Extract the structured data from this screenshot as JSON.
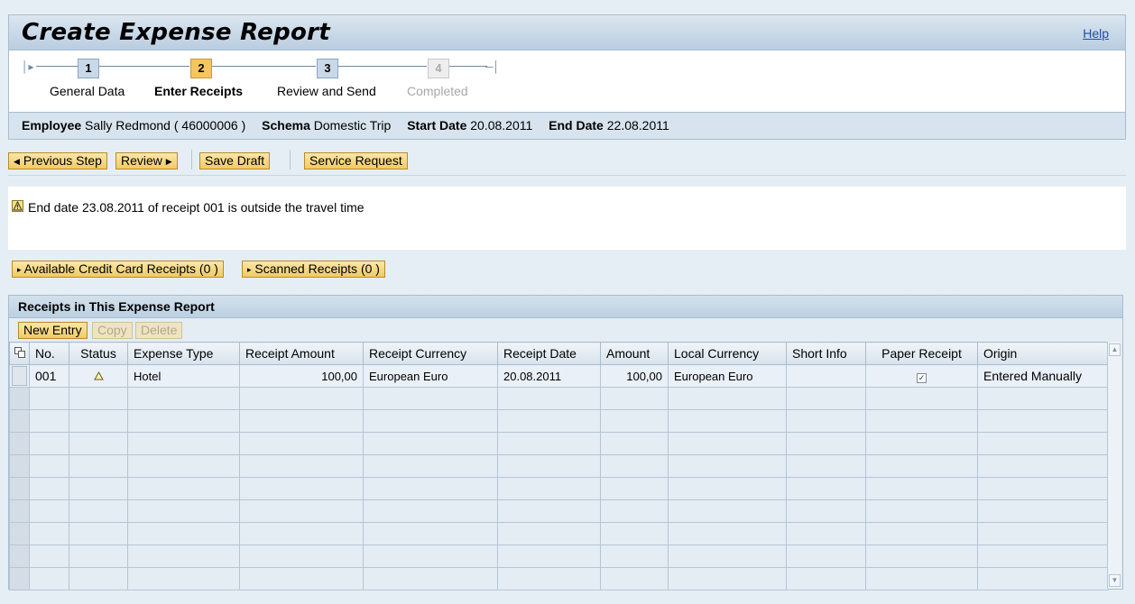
{
  "header": {
    "title": "Create Expense Report",
    "help": "Help"
  },
  "roadmap": {
    "steps": [
      {
        "number": "1",
        "label": "General Data"
      },
      {
        "number": "2",
        "label": "Enter Receipts"
      },
      {
        "number": "3",
        "label": "Review and Send"
      },
      {
        "number": "4",
        "label": "Completed"
      }
    ],
    "active_step": "2"
  },
  "info": {
    "employee_label": "Employee",
    "employee_value": "Sally Redmond ( 46000006 )",
    "schema_label": "Schema",
    "schema_value": "Domestic Trip",
    "start_label": "Start Date",
    "start_value": "20.08.2011",
    "end_label": "End Date",
    "end_value": "22.08.2011"
  },
  "actions": {
    "previous": "Previous Step",
    "review": "Review",
    "save_draft": "Save Draft",
    "service_request": "Service Request"
  },
  "message": {
    "type": "warning",
    "text": "End date 23.08.2011 of receipt 001 is outside the travel time"
  },
  "expanders": {
    "credit_card": "Available Credit Card Receipts (0 )",
    "scanned": "Scanned Receipts (0 )"
  },
  "receipts": {
    "title": "Receipts in This Expense Report",
    "toolbar": {
      "new_entry": "New Entry",
      "copy": "Copy",
      "delete": "Delete"
    },
    "columns": [
      "No.",
      "Status",
      "Expense Type",
      "Receipt Amount",
      "Receipt Currency",
      "Receipt Date",
      "Amount",
      "Local Currency",
      "Short Info",
      "Paper Receipt",
      "Origin"
    ],
    "rows": [
      {
        "no": "001",
        "status": "warning",
        "expense_type": "Hotel",
        "receipt_amount": "100,00",
        "receipt_currency": "European Euro",
        "receipt_date": "20.08.2011",
        "amount": "100,00",
        "local_currency": "European Euro",
        "short_info": "",
        "paper_receipt": true,
        "origin": "Entered Manually"
      }
    ],
    "empty_rows": 9
  },
  "colors": {
    "accent": "#f1ca64",
    "header_bg": "#b9cde0",
    "link": "#1f50a6"
  }
}
